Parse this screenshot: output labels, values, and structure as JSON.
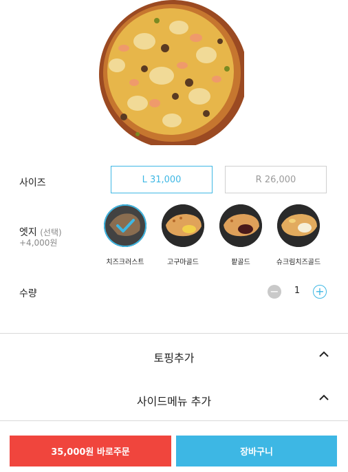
{
  "product": {
    "image_icon": "pizza-image"
  },
  "size": {
    "label": "사이즈",
    "options": [
      {
        "label": "L 31,000",
        "selected": true
      },
      {
        "label": "R 26,000",
        "selected": false
      }
    ]
  },
  "edge": {
    "label": "엣지",
    "label_note": "(선택)",
    "price": "+4,000원",
    "options": [
      {
        "name": "치즈크러스트",
        "selected": true
      },
      {
        "name": "고구마골드",
        "selected": false
      },
      {
        "name": "팥골드",
        "selected": false
      },
      {
        "name": "슈크림치즈골드",
        "selected": false
      }
    ]
  },
  "quantity": {
    "label": "수량",
    "value": "1",
    "minus": "−",
    "plus": "+"
  },
  "accordion": {
    "topping": "토핑추가",
    "side_menu": "사이드메뉴 추가"
  },
  "actions": {
    "order_label": "35,000원 바로주문",
    "cart_label": "장바구니"
  },
  "colors": {
    "accent": "#3db7e4",
    "order": "#f0453d",
    "disabled": "#c9c9c9"
  }
}
